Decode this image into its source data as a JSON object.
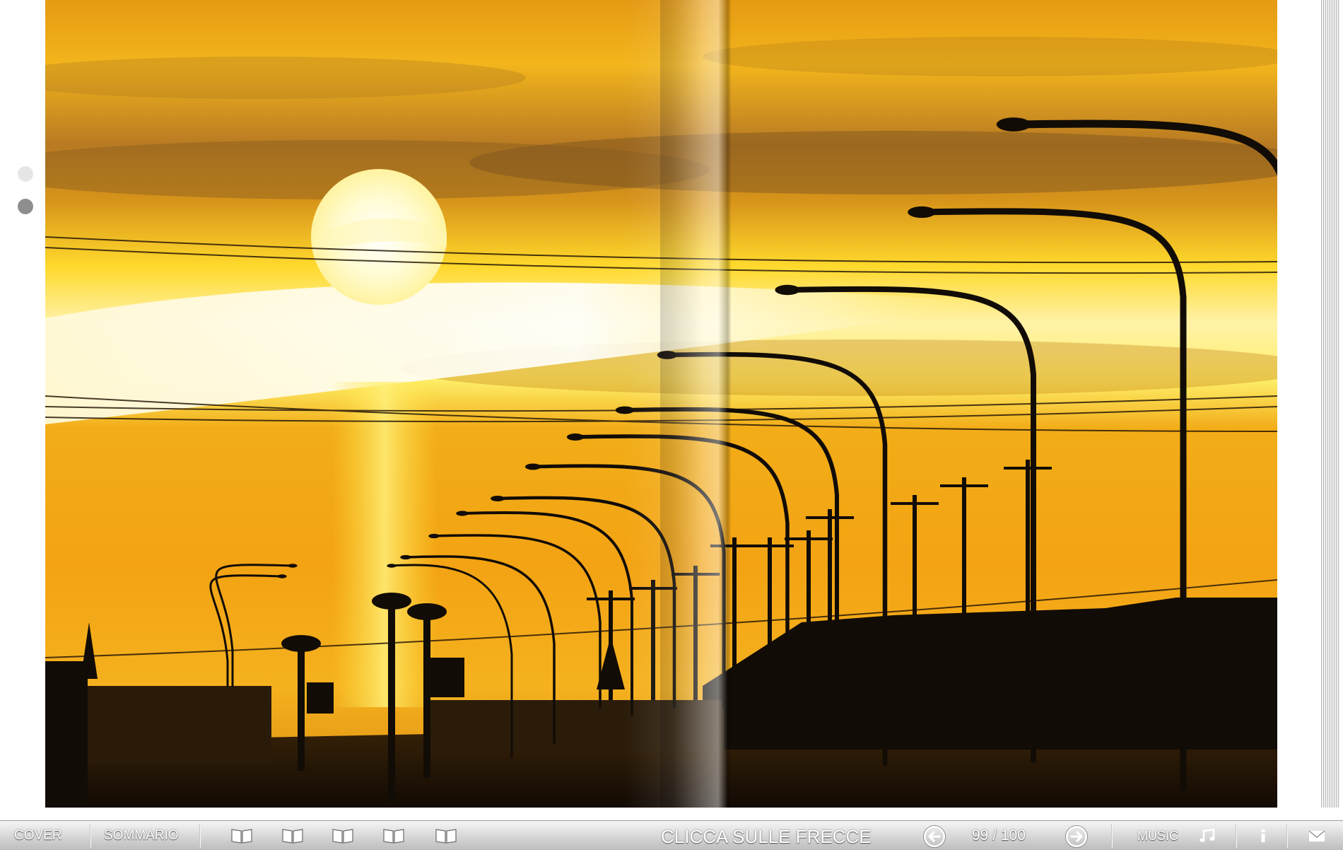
{
  "navigation": {
    "cover_label": "COVER",
    "contents_label": "SOMMARIO",
    "book_view_icons": [
      "open-book-icon",
      "open-book-icon",
      "open-book-icon",
      "open-book-icon",
      "open-book-icon"
    ],
    "instruction_text": "CLICCA SULLE FRECCE",
    "prev_icon": "arrow-left-circle-icon",
    "next_icon": "arrow-right-circle-icon",
    "current_page": "99",
    "total_pages": "100",
    "page_counter_text": "99 / 100",
    "music_label": "MUSIC",
    "music_icon": "music-note-icon",
    "info_icon": "info-icon",
    "mail_icon": "envelope-icon"
  },
  "page_indicator": {
    "dots": 2,
    "active_dot": 2
  },
  "spread": {
    "image_subject": "street-lamps-sunset-photo"
  },
  "colors": {
    "sky_top": "#e48a0c",
    "sky_bright": "#ffe93a",
    "sun": "#fff8c8",
    "silhouette": "#120c06",
    "toolbar_top": "#f6f6f6",
    "toolbar_bottom": "#bdbdbd",
    "toolbar_text": "#ffffff"
  }
}
